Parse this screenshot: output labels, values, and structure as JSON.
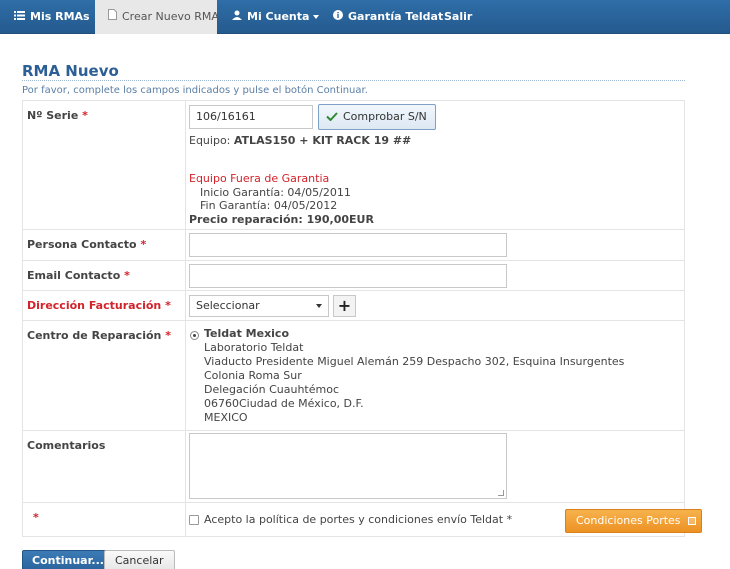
{
  "nav": {
    "items": [
      {
        "label": "Mis RMAs",
        "icon": "list-icon"
      },
      {
        "label": "Crear Nuevo RMA",
        "icon": "document-icon"
      },
      {
        "label": "Mi Cuenta",
        "icon": "user-icon"
      },
      {
        "label": "Garantía Teldat",
        "icon": "info-icon"
      },
      {
        "label": "Salir",
        "icon": ""
      }
    ],
    "active": "Crear Nuevo RMA",
    "bg_color": "#2a64a0"
  },
  "page": {
    "title": "RMA Nuevo",
    "instructions": "Por favor, complete los campos indicados y pulse el botón Continuar."
  },
  "form": {
    "serial": {
      "label": "Nº Serie",
      "required_mark": "*",
      "value": "106/16161",
      "check_button": "Comprobar S/N",
      "equipo_label": "Equipo:",
      "equipo_value": "ATLAS150 + KIT RACK 19 ##",
      "warranty_status": "Equipo Fuera de Garantia",
      "inicio": "Inicio Garantía: 04/05/2011",
      "fin": "Fin Garantía: 04/05/2012",
      "precio": "Precio reparación: 190,00EUR"
    },
    "contacto": {
      "label": "Persona Contacto",
      "required_mark": "*",
      "value": ""
    },
    "email": {
      "label": "Email Contacto",
      "required_mark": "*",
      "value": ""
    },
    "direccion": {
      "label": "Dirección Facturación",
      "required_mark": "*",
      "selected": "Seleccionar"
    },
    "centro": {
      "label": "Centro de Reparación",
      "required_mark": "*",
      "name": "Teldat Mexico",
      "lines": [
        "Laboratorio Teldat",
        "Viaducto Presidente Miguel Alemán 259 Despacho 302, Esquina Insurgentes",
        "Colonia Roma Sur",
        "Delegación Cuauhtémoc",
        "06760Ciudad de México, D.F.",
        "MEXICO"
      ]
    },
    "comentarios": {
      "label": "Comentarios",
      "value": ""
    },
    "terms": {
      "required_mark": "*",
      "label": "Acepto la política de portes y condiciones envío Teldat",
      "trailing_mark": "*",
      "button": "Condiciones Portes"
    }
  },
  "actions": {
    "continue": "Continuar...",
    "cancel": "Cancelar"
  },
  "colors": {
    "accent": "#2b5f95",
    "required": "#d2232a",
    "orange": "#ec9224"
  }
}
